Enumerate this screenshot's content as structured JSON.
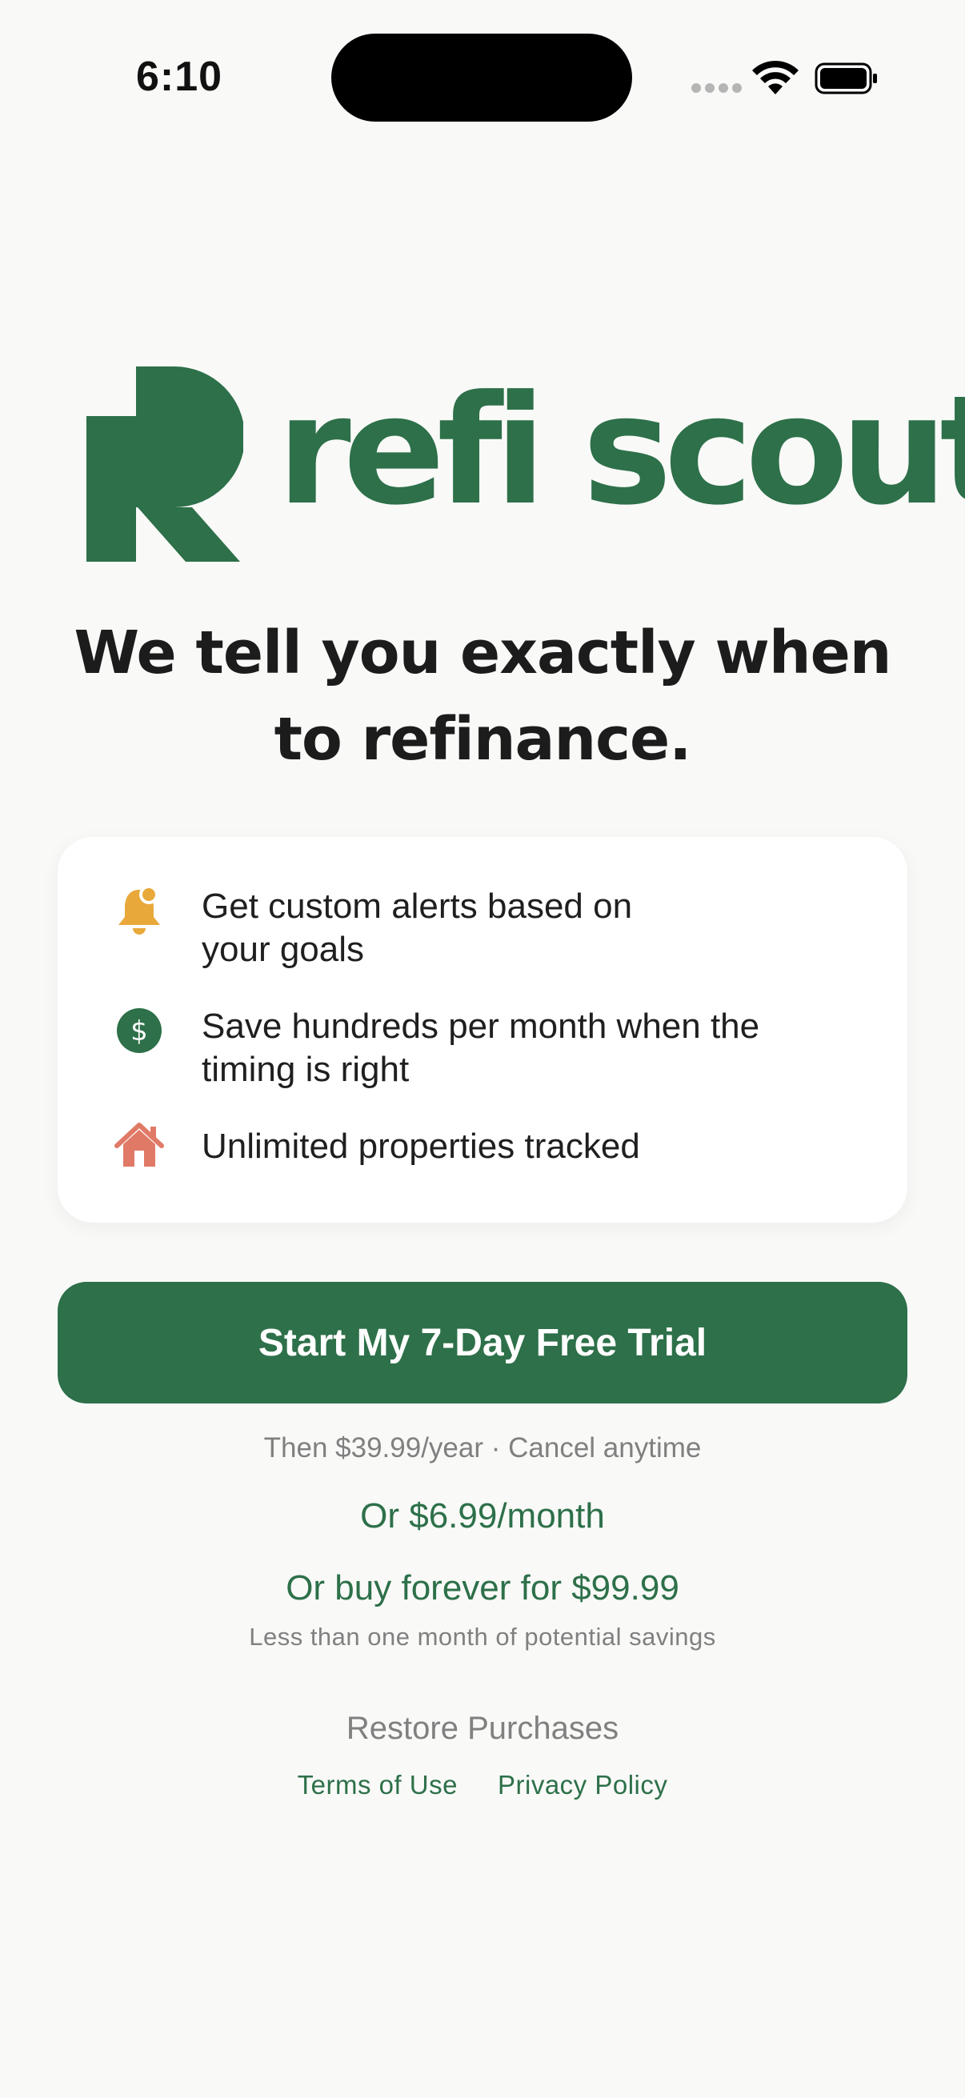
{
  "status_bar": {
    "time": "6:10",
    "icons": [
      "cellular-signal-icon",
      "wifi-icon",
      "battery-icon"
    ]
  },
  "brand": {
    "name": "refi scout",
    "color": "#2d7049",
    "logo_icon": "r-monogram-logo"
  },
  "headline": {
    "line1": "We tell you exactly when",
    "line2": "to refinance."
  },
  "features": [
    {
      "icon": "bell-icon",
      "color": "#e8a93a",
      "line1": "Get custom alerts based on",
      "line2": "your goals"
    },
    {
      "icon": "dollar-icon",
      "color": "#2d7049",
      "line1": "Save hundreds per month when the",
      "line2": "timing is right"
    },
    {
      "icon": "house-icon",
      "color": "#e07a66",
      "line1": "Unlimited properties tracked",
      "line2": ""
    }
  ],
  "cta": {
    "label": "Start My 7-Day Free Trial"
  },
  "pricing": {
    "then": "Then $39.99/year · Cancel anytime",
    "monthly": "Or $6.99/month",
    "forever": "Or buy forever for $99.99",
    "savings_note": "Less than one month of potential savings"
  },
  "footer": {
    "restore": "Restore Purchases",
    "terms": "Terms of Use",
    "privacy": "Privacy Policy"
  }
}
